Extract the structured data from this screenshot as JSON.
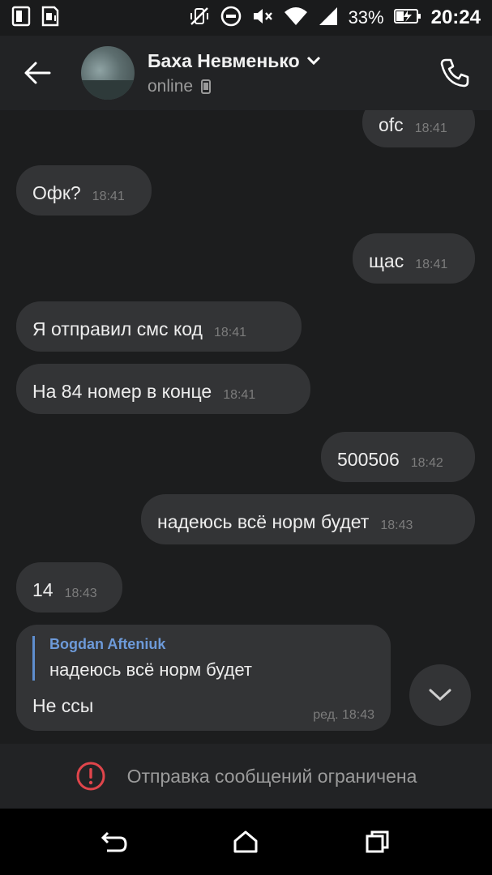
{
  "status_bar": {
    "battery_percent": "33%",
    "time": "20:24",
    "icons": [
      "sim-card-icon",
      "sd-card-icon",
      "vibrate-off-icon",
      "do-not-disturb-icon",
      "mute-icon",
      "wifi-icon",
      "signal-icon",
      "battery-charging-icon"
    ]
  },
  "header": {
    "name": "Баха Невменько",
    "status": "online",
    "icons": [
      "back-arrow-icon",
      "chevron-down-icon",
      "phone-device-icon",
      "phone-call-icon"
    ]
  },
  "messages": [
    {
      "dir": "out",
      "text": "ofc",
      "time": "18:41"
    },
    {
      "dir": "in",
      "text": "Офк?",
      "time": "18:41"
    },
    {
      "dir": "out",
      "text": "щас",
      "time": "18:41"
    },
    {
      "dir": "in",
      "text": "Я отправил смс код",
      "time": "18:41"
    },
    {
      "dir": "in",
      "text": "На 84 номер в конце",
      "time": "18:41"
    },
    {
      "dir": "out",
      "text": "500506",
      "time": "18:42"
    },
    {
      "dir": "out",
      "text": "надеюсь всё норм будет",
      "time": "18:43"
    },
    {
      "dir": "in",
      "text": "14",
      "time": "18:43"
    }
  ],
  "reply_message": {
    "quote_author": "Bogdan Afteniuk",
    "quote_text": "надеюсь всё норм будет",
    "text": "Не ссы",
    "time": "ред. 18:43"
  },
  "restricted_notice": "Отправка сообщений ограничена",
  "colors": {
    "background": "#1c1d1e",
    "bubble": "#333436",
    "accent_blue": "#6d9ad9",
    "error_red": "#e0454b"
  }
}
